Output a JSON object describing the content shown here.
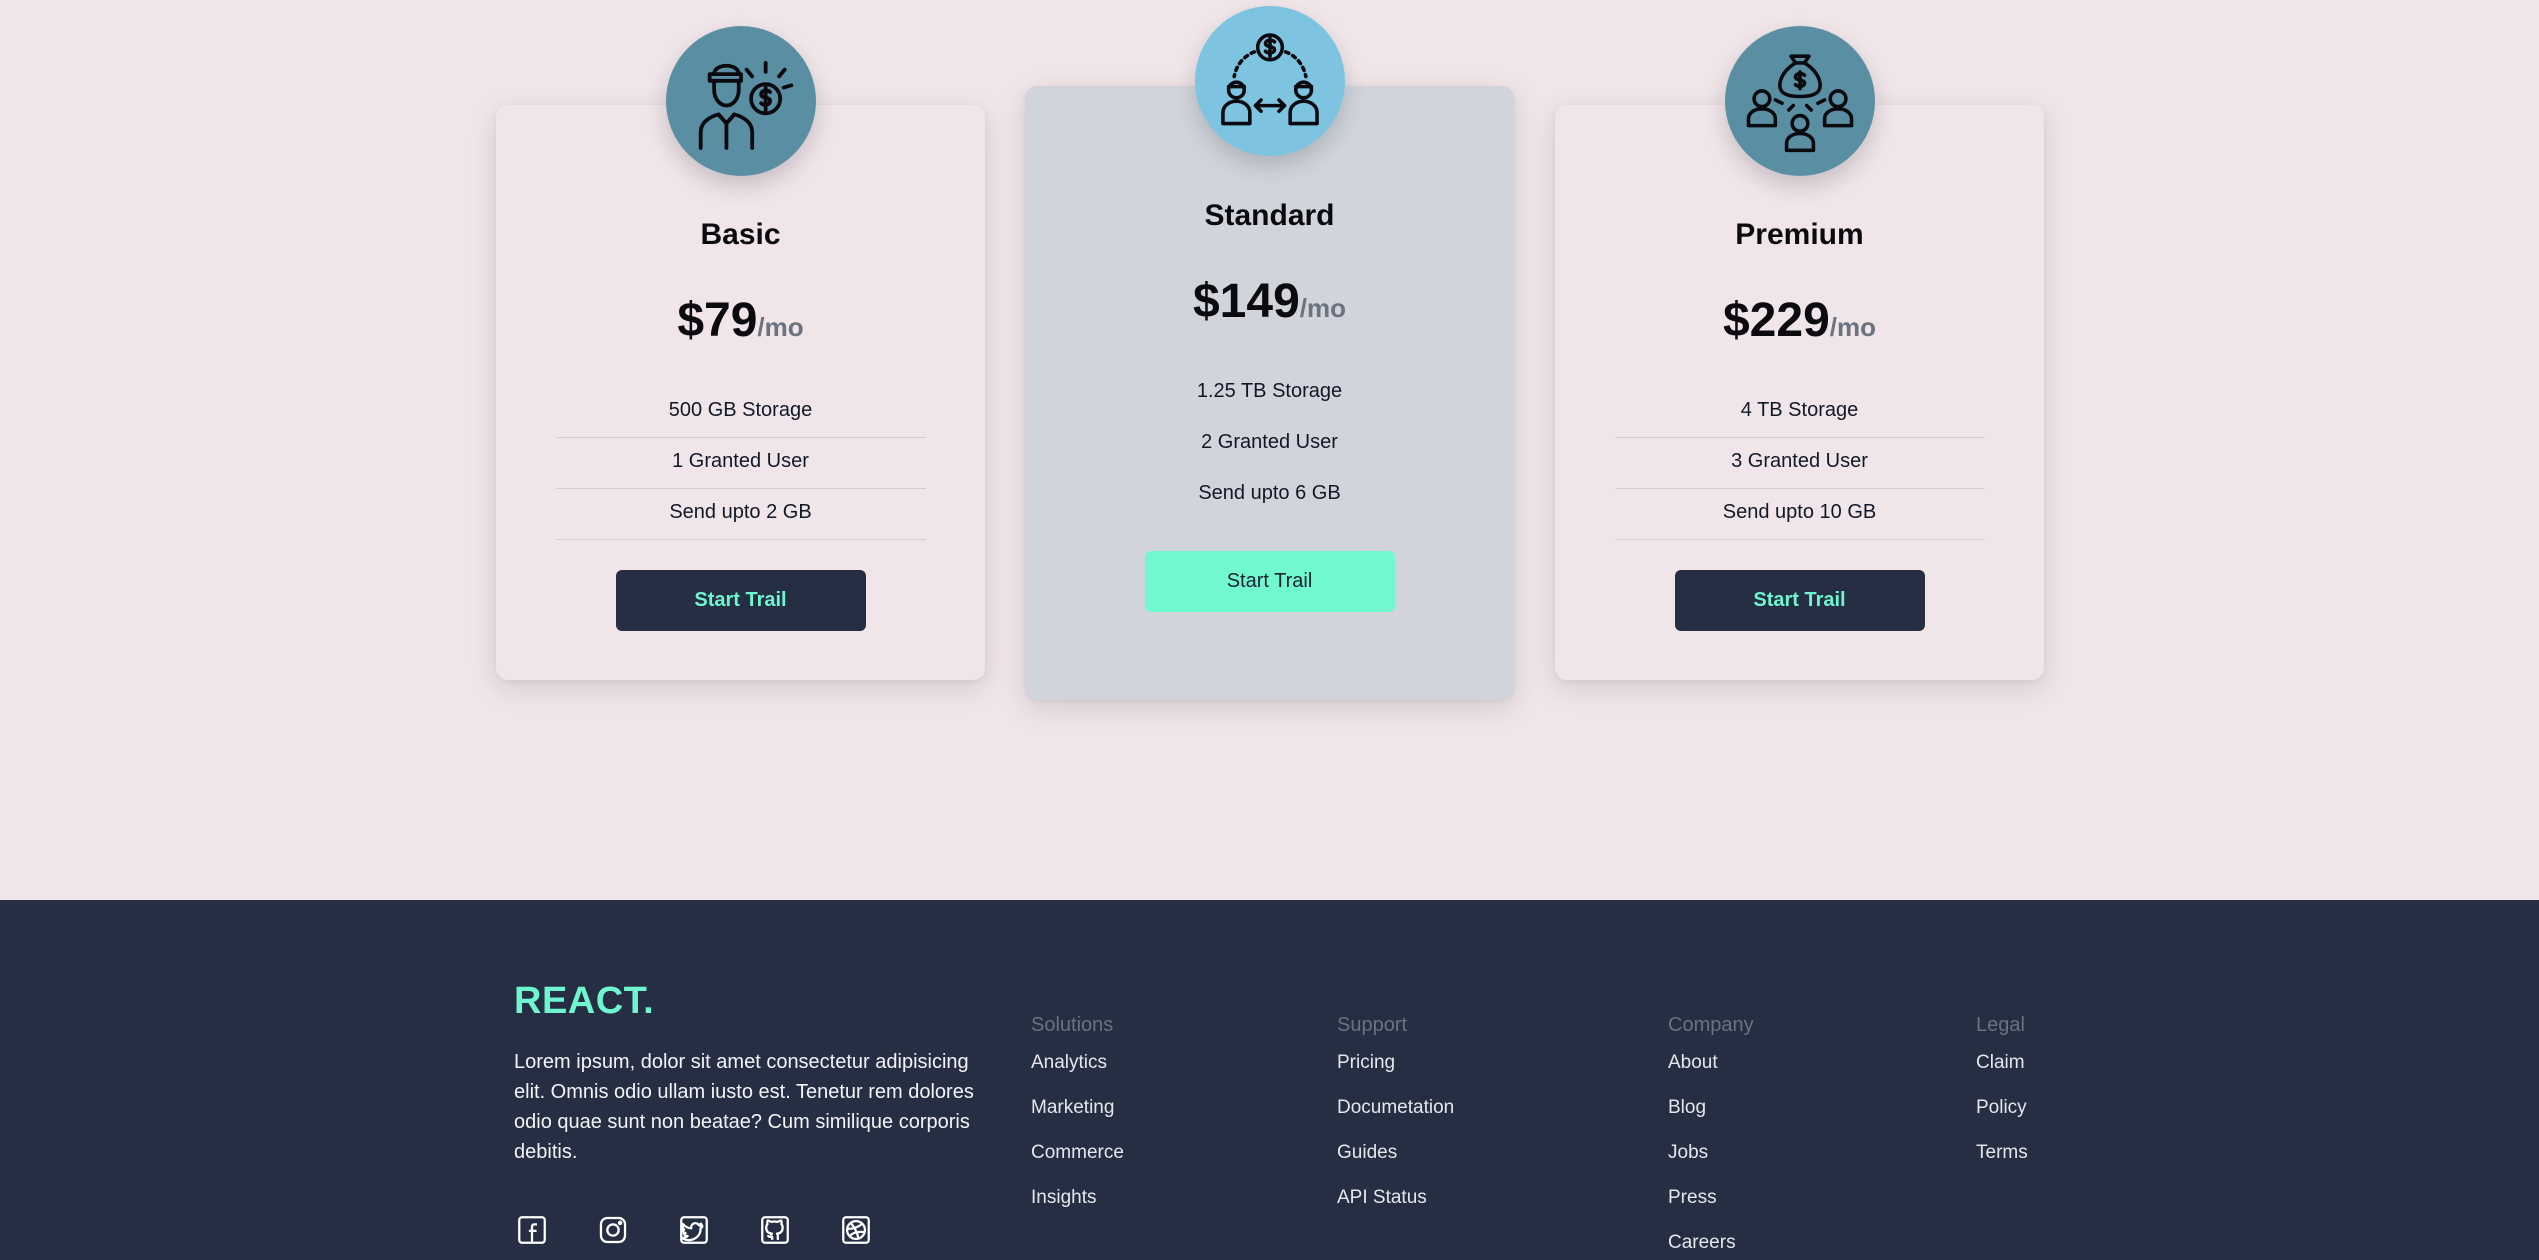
{
  "plans": [
    {
      "name": "Basic",
      "price": "$79",
      "period": "/mo",
      "icon": "salesman-dollar-icon",
      "features": [
        "500 GB Storage",
        "1 Granted User",
        "Send upto 2 GB"
      ],
      "cta": "Start Trail",
      "avatar_color": "#5a8fa3"
    },
    {
      "name": "Standard",
      "price": "$149",
      "period": "/mo",
      "icon": "money-transfer-icon",
      "features": [
        "1.25 TB Storage",
        "2 Granted User",
        "Send upto 6 GB"
      ],
      "cta": "Start Trail",
      "avatar_color": "#7ec3e0",
      "highlighted": true
    },
    {
      "name": "Premium",
      "price": "$229",
      "period": "/mo",
      "icon": "money-bag-group-icon",
      "features": [
        "4 TB Storage",
        "3 Granted User",
        "Send upto 10 GB"
      ],
      "cta": "Start Trail",
      "avatar_color": "#5a8fa3"
    }
  ],
  "footer": {
    "brand": "REACT.",
    "description": "Lorem ipsum, dolor sit amet consectetur adipisicing elit. Omnis odio ullam iusto est. Tenetur rem dolores odio quae sunt non beatae? Cum similique corporis debitis.",
    "socials": [
      "facebook-icon",
      "instagram-icon",
      "twitter-icon",
      "github-icon",
      "dribbble-icon"
    ],
    "columns": [
      {
        "title": "Solutions",
        "links": [
          "Analytics",
          "Marketing",
          "Commerce",
          "Insights"
        ]
      },
      {
        "title": "Support",
        "links": [
          "Pricing",
          "Documetation",
          "Guides",
          "API Status"
        ]
      },
      {
        "title": "Company",
        "links": [
          "About",
          "Blog",
          "Jobs",
          "Press",
          "Careers"
        ]
      },
      {
        "title": "Legal",
        "links": [
          "Claim",
          "Policy",
          "Terms"
        ]
      }
    ]
  },
  "colors": {
    "page_bg": "#f0e5e8",
    "footer_bg": "#252e42",
    "accent": "#6ff5cf",
    "highlight_card": "#d1d5db"
  }
}
